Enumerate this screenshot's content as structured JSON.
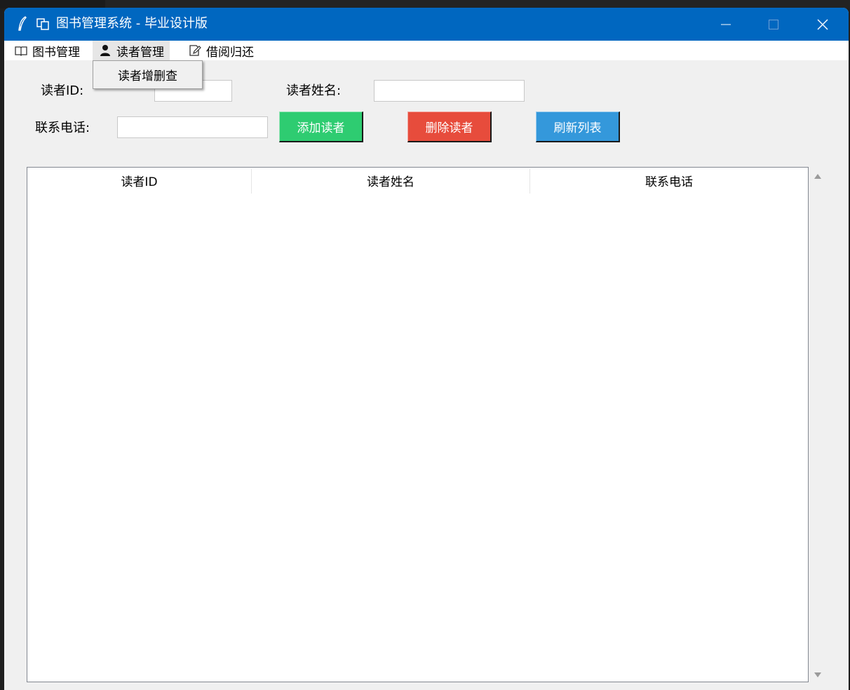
{
  "window": {
    "title": "图书管理系统 - 毕业设计版",
    "app_icon": "feather-icon",
    "title_icon": "copy-pages-icon",
    "controls": {
      "minimize_icon": "minimize-icon",
      "maximize_icon": "maximize-icon",
      "close_icon": "close-icon"
    }
  },
  "menubar": {
    "items": [
      {
        "label": "图书管理",
        "icon": "book-icon"
      },
      {
        "label": "读者管理",
        "icon": "person-icon",
        "active": true
      },
      {
        "label": "借阅归还",
        "icon": "edit-icon"
      }
    ],
    "open_dropdown": {
      "items": [
        {
          "label": "读者增删查"
        }
      ]
    }
  },
  "form": {
    "reader_id_label": "读者ID:",
    "reader_id_value": "",
    "reader_name_label": "读者姓名:",
    "reader_name_value": "",
    "phone_label": "联系电话:",
    "phone_value": ""
  },
  "buttons": {
    "add_label": "添加读者",
    "delete_label": "删除读者",
    "refresh_label": "刷新列表"
  },
  "table": {
    "columns": [
      "读者ID",
      "读者姓名",
      "联系电话"
    ],
    "rows": []
  },
  "colors": {
    "titlebar": "#0067c0",
    "add_button": "#2ecc71",
    "delete_button": "#e74c3c",
    "refresh_button": "#3498db",
    "window_bg": "#f0f0f0"
  }
}
